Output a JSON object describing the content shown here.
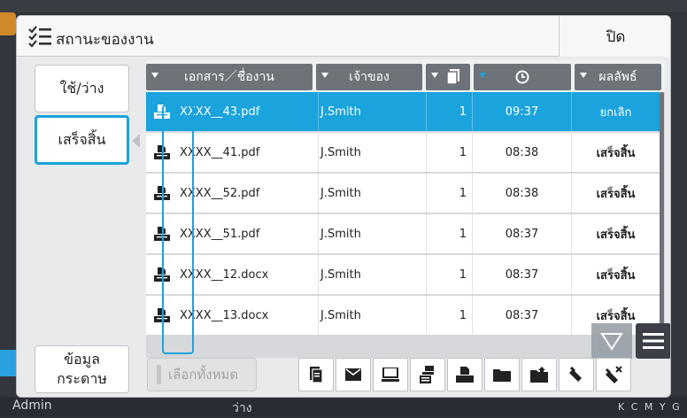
{
  "background": {
    "user": "Admin",
    "status": "ว่าง",
    "ink_labels": "K C M Y G"
  },
  "titlebar": {
    "title": "สถานะของงาน",
    "close_label": "ปิด"
  },
  "sidebar": {
    "items": [
      {
        "label": "ใช้/ว่าง",
        "active": false
      },
      {
        "label": "เสร็จสิ้น",
        "active": true
      }
    ],
    "paper_info_label": "ข้อมูล\nกระดาษ"
  },
  "table": {
    "columns": [
      "เอกสาร／ชื่องาน",
      "เจ้าของ",
      "",
      "",
      "ผลลัพธ์"
    ],
    "rows": [
      {
        "name": "XXXX__43.pdf",
        "owner": "J.Smith",
        "pages": "1",
        "time": "09:37",
        "result": "ยกเลิก",
        "selected": true
      },
      {
        "name": "XXXX__41.pdf",
        "owner": "J.Smith",
        "pages": "1",
        "time": "08:38",
        "result": "เสร็จสิ้น",
        "selected": false
      },
      {
        "name": "XXXX__52.pdf",
        "owner": "J.Smith",
        "pages": "1",
        "time": "08:38",
        "result": "เสร็จสิ้น",
        "selected": false
      },
      {
        "name": "XXXX__51.pdf",
        "owner": "J.Smith",
        "pages": "1",
        "time": "08:37",
        "result": "เสร็จสิ้น",
        "selected": false
      },
      {
        "name": "XXXX__12.docx",
        "owner": "J.Smith",
        "pages": "1",
        "time": "08:37",
        "result": "เสร็จสิ้น",
        "selected": false
      },
      {
        "name": "XXXX__13.docx",
        "owner": "J.Smith",
        "pages": "1",
        "time": "08:37",
        "result": "เสร็จสิ้น",
        "selected": false
      }
    ]
  },
  "toolbar": {
    "select_all_label": "เลือกทั้งหมด",
    "tools": [
      "details-icon",
      "mail-icon",
      "computer-icon",
      "copy-icon",
      "print-icon",
      "folder-icon",
      "save-to-folder-icon",
      "usb-icon",
      "delete-usb-icon"
    ]
  },
  "colors": {
    "accent": "#1aa3dc",
    "header": "#6e7379"
  }
}
